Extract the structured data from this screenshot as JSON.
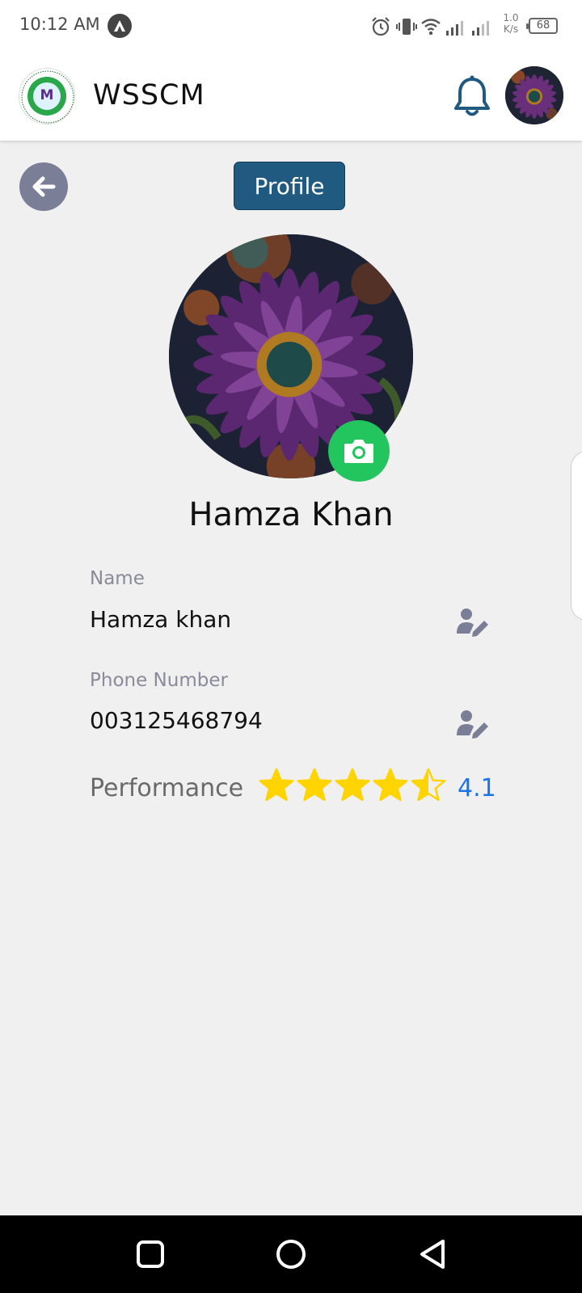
{
  "status_bar": {
    "time": "10:12 AM",
    "net_speed_value": "1.0",
    "net_speed_unit": "K/s",
    "battery": "68"
  },
  "header": {
    "title": "WSSCM",
    "logo_letter": "M",
    "logo_ring_text": "WATER AND SANITATION SERVICES COMPANY MARDAN"
  },
  "page": {
    "profile_button": "Profile"
  },
  "profile": {
    "display_name": "Hamza Khan",
    "fields": [
      {
        "label": "Name",
        "value": "Hamza khan"
      },
      {
        "label": "Phone Number",
        "value": "003125468794"
      }
    ],
    "performance_label": "Performance",
    "rating": "4.1",
    "rating_value": 4.1,
    "rating_max": 5
  },
  "colors": {
    "header_accent": "#205a80",
    "camera_button": "#22c55e",
    "star": "#ffd400",
    "rating_text": "#1a73e8"
  }
}
